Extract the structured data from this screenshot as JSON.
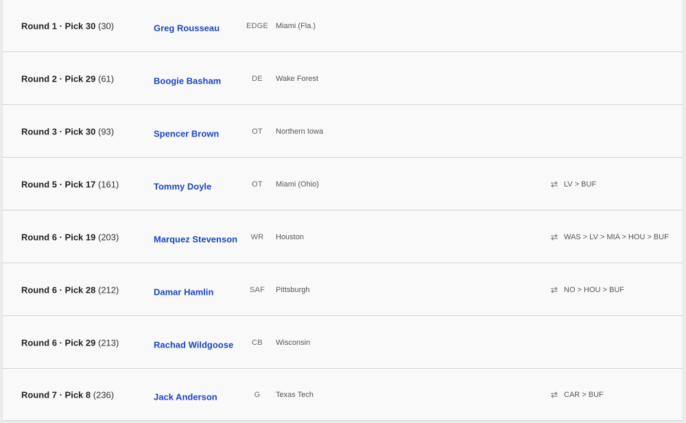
{
  "picks": [
    {
      "round_pick": "Round 1 · Pick 30",
      "overall": "(30)",
      "player": "Greg Rousseau",
      "position": "EDGE",
      "school": "Miami (Fla.)",
      "trade": ""
    },
    {
      "round_pick": "Round 2 · Pick 29",
      "overall": "(61)",
      "player": "Boogie Basham",
      "position": "DE",
      "school": "Wake Forest",
      "trade": ""
    },
    {
      "round_pick": "Round 3 · Pick 30",
      "overall": "(93)",
      "player": "Spencer Brown",
      "position": "OT",
      "school": "Northern Iowa",
      "trade": ""
    },
    {
      "round_pick": "Round 5 · Pick 17",
      "overall": "(161)",
      "player": "Tommy Doyle",
      "position": "OT",
      "school": "Miami (Ohio)",
      "trade": "LV > BUF"
    },
    {
      "round_pick": "Round 6 · Pick 19",
      "overall": "(203)",
      "player": "Marquez Stevenson",
      "position": "WR",
      "school": "Houston",
      "trade": "WAS > LV > MIA > HOU > BUF"
    },
    {
      "round_pick": "Round 6 · Pick 28",
      "overall": "(212)",
      "player": "Damar Hamlin",
      "position": "SAF",
      "school": "Pittsburgh",
      "trade": "NO > HOU > BUF"
    },
    {
      "round_pick": "Round 6 · Pick 29",
      "overall": "(213)",
      "player": "Rachad Wildgoose",
      "position": "CB",
      "school": "Wisconsin",
      "trade": ""
    },
    {
      "round_pick": "Round 7 · Pick 8",
      "overall": "(236)",
      "player": "Jack Anderson",
      "position": "G",
      "school": "Texas Tech",
      "trade": "CAR > BUF"
    }
  ],
  "icons": {
    "trade": "swap-arrows-icon"
  },
  "colors": {
    "player_link": "#1a46c4",
    "row_bg": "#f9f9f9",
    "divider": "#d3d3d3"
  }
}
